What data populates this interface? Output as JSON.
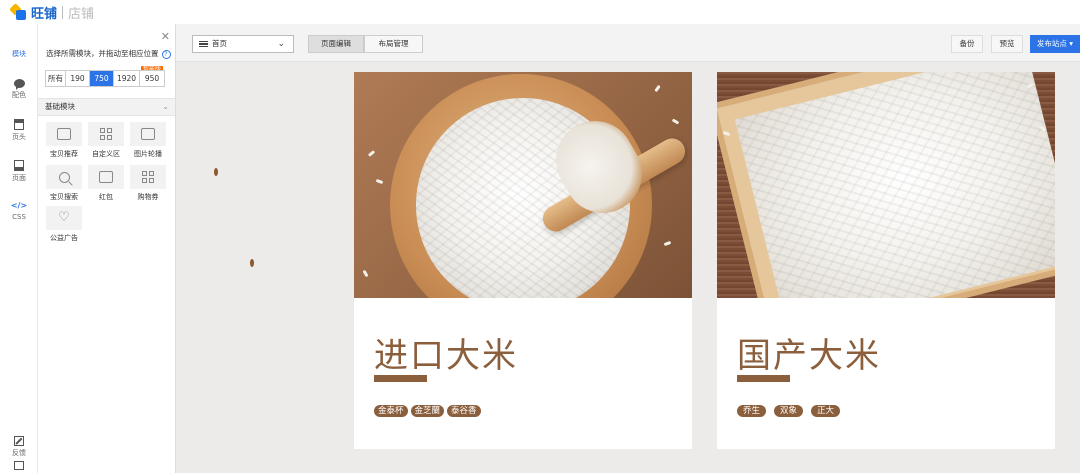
{
  "brand": {
    "name": "旺铺",
    "sub": "店铺"
  },
  "rail": {
    "items": [
      {
        "label": "模块",
        "icon": "modules-icon",
        "active": true
      },
      {
        "label": "配色",
        "icon": "color-icon"
      },
      {
        "label": "页头",
        "icon": "page-header-icon"
      },
      {
        "label": "页面",
        "icon": "page-icon"
      },
      {
        "label": "CSS",
        "icon": "code-icon"
      }
    ],
    "feedback": "反馈"
  },
  "panel": {
    "hint": "选择所需模块，并拖动至相应位置",
    "widths": [
      "所有",
      "190",
      "750",
      "1920",
      "950"
    ],
    "active_width": "750",
    "badge": "智能版",
    "section": "基础模块",
    "modules": [
      {
        "label": "宝贝推荐",
        "icon": "product-recommend-icon"
      },
      {
        "label": "自定义区",
        "icon": "custom-area-icon"
      },
      {
        "label": "图片轮播",
        "icon": "image-carousel-icon"
      },
      {
        "label": "宝贝搜索",
        "icon": "product-search-icon"
      },
      {
        "label": "红包",
        "icon": "red-packet-icon"
      },
      {
        "label": "购物券",
        "icon": "coupon-icon"
      },
      {
        "label": "公益广告",
        "icon": "charity-ad-icon"
      }
    ]
  },
  "toolbar": {
    "page_select": "首页",
    "tabs": [
      "页面编辑",
      "布局管理"
    ],
    "active_tab": "页面编辑",
    "backup": "备份",
    "preview": "预览",
    "publish": "发布站点"
  },
  "cards": [
    {
      "title": "进口大米",
      "tags": [
        "金泰杯",
        "金芝蘭",
        "泰谷香"
      ]
    },
    {
      "title": "国产大米",
      "tags": [
        "乔生",
        "双象",
        "正大"
      ]
    }
  ],
  "colors": {
    "accent": "#2b73e6",
    "brown": "#8b5e3c",
    "badge": "#ff6a00"
  }
}
